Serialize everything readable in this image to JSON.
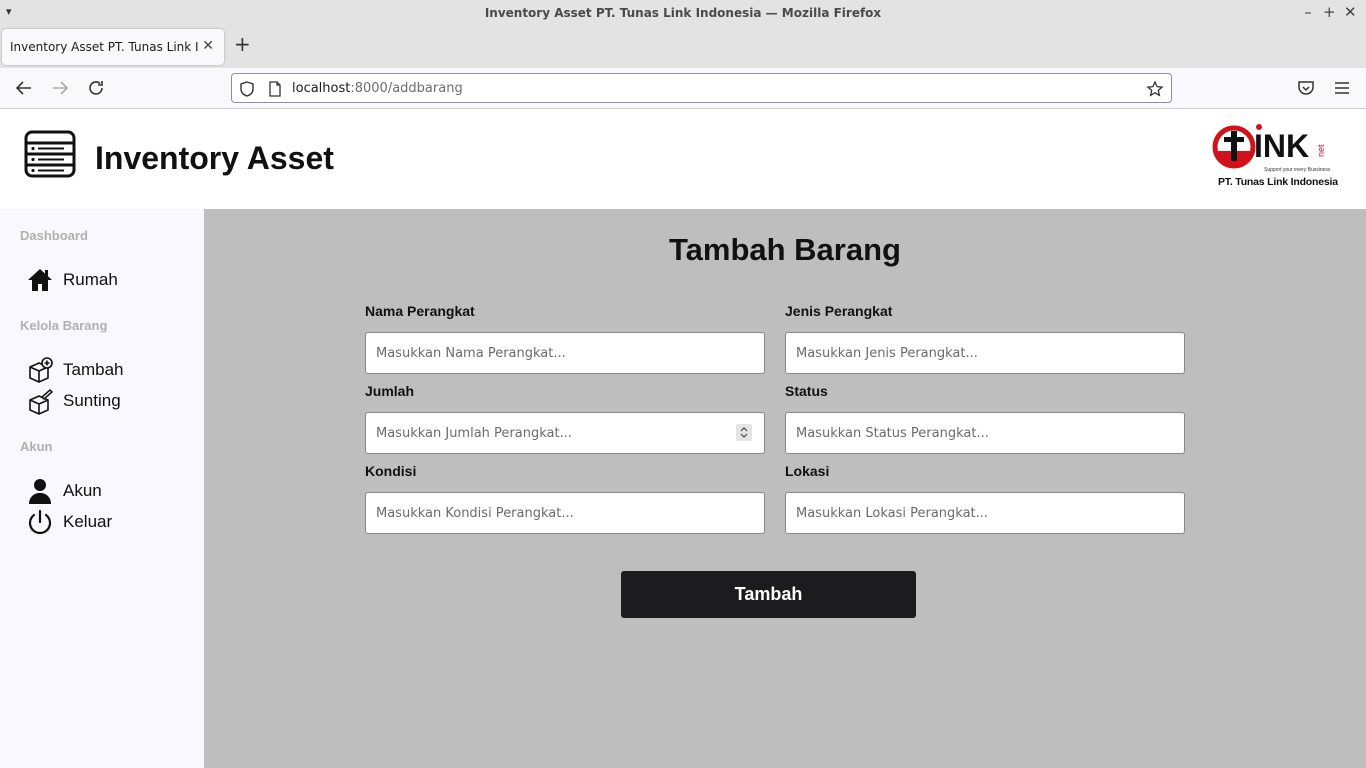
{
  "browser": {
    "window_title": "Inventory Asset PT. Tunas Link Indonesia — Mozilla Firefox",
    "tab_title": "Inventory Asset PT. Tunas Link Indonesia",
    "url_host": "localhost",
    "url_path": ":8000/addbarang"
  },
  "header": {
    "title": "Inventory Asset",
    "brand_name": "PT. Tunas Link Indonesia",
    "brand_tagline": "Support your every Bussiness",
    "brand_colors": {
      "red": "#d0121b",
      "black": "#111111"
    }
  },
  "sidebar": {
    "sections": [
      {
        "title": "Dashboard",
        "items": [
          {
            "label": "Rumah",
            "icon": "home-icon"
          }
        ]
      },
      {
        "title": "Kelola Barang",
        "items": [
          {
            "label": "Tambah",
            "icon": "box-add-icon"
          },
          {
            "label": "Sunting",
            "icon": "box-edit-icon"
          }
        ]
      },
      {
        "title": "Akun",
        "items": [
          {
            "label": "Akun",
            "icon": "user-icon"
          },
          {
            "label": "Keluar",
            "icon": "power-icon"
          }
        ]
      }
    ]
  },
  "form": {
    "title": "Tambah Barang",
    "fields": [
      {
        "label": "Nama Perangkat",
        "placeholder": "Masukkan Nama Perangkat..."
      },
      {
        "label": "Jenis Perangkat",
        "placeholder": "Masukkan Jenis Perangkat..."
      },
      {
        "label": "Jumlah",
        "placeholder": "Masukkan Jumlah Perangkat..."
      },
      {
        "label": "Status",
        "placeholder": "Masukkan Status Perangkat..."
      },
      {
        "label": "Kondisi",
        "placeholder": "Masukkan Kondisi Perangkat..."
      },
      {
        "label": "Lokasi",
        "placeholder": "Masukkan Lokasi Perangkat..."
      }
    ],
    "submit_label": "Tambah"
  },
  "colors": {
    "main_bg": "#bebebe",
    "sidebar_bg": "#f8f8fe",
    "button_bg": "#1c1c1e"
  }
}
